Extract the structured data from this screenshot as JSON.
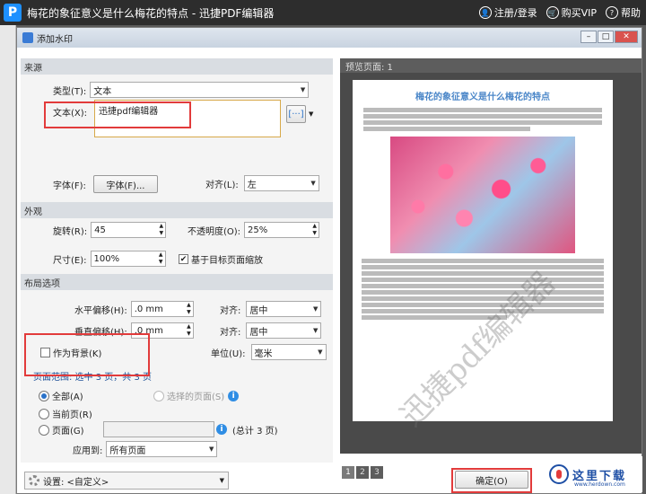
{
  "titlebar": {
    "logo_glyph": "P",
    "title": "梅花的象征意义是什么梅花的特点 - 迅捷PDF编辑器",
    "register_login": "注册/登录",
    "buy_vip": "购买VIP",
    "help": "帮助"
  },
  "dialog": {
    "title": "添加水印",
    "source": {
      "header": "来源",
      "type_label": "类型(T):",
      "type_value": "文本",
      "text_label": "文本(X):",
      "text_value": "迅捷pdf编辑器",
      "font_label": "字体(F):",
      "font_button": "字体(F)...",
      "align_label": "对齐(L):",
      "align_value": "左"
    },
    "appearance": {
      "header": "外观",
      "rotation_label": "旋转(R):",
      "rotation_value": "45",
      "opacity_label": "不透明度(O):",
      "opacity_value": "25%",
      "size_label": "尺寸(E):",
      "size_value": "100%",
      "scale_checkbox": "基于目标页面缩放"
    },
    "layout": {
      "header": "布局选项",
      "h_offset_label": "水平偏移(H):",
      "h_offset_value": ".0 mm",
      "h_align_label": "对齐:",
      "h_align_value": "居中",
      "v_offset_label": "垂直偏移(H):",
      "v_offset_value": ".0 mm",
      "v_align_label": "对齐:",
      "v_align_value": "居中",
      "background_checkbox": "作为背景(K)",
      "unit_label": "单位(U):",
      "unit_value": "毫米"
    },
    "page_range": {
      "header": "页面范围: 选中 3 页，共 3 页",
      "all": "全部(A)",
      "selected": "选择的页面(S)",
      "current": "当前页(R)",
      "pages": "页面(G)",
      "total": "(总计 3 页)",
      "apply_label": "应用到:",
      "apply_value": "所有页面"
    },
    "preview": {
      "header": "预览页面: 1",
      "page_title": "梅花的象征意义是什么梅花的特点",
      "watermark": "迅捷pdf编辑器",
      "pages": [
        "1",
        "2",
        "3"
      ]
    },
    "settings_label": "设置: <自定义>",
    "ok_button": "确定(O)"
  },
  "brand": {
    "name": "这里下载",
    "url": "www.herdown.com"
  }
}
